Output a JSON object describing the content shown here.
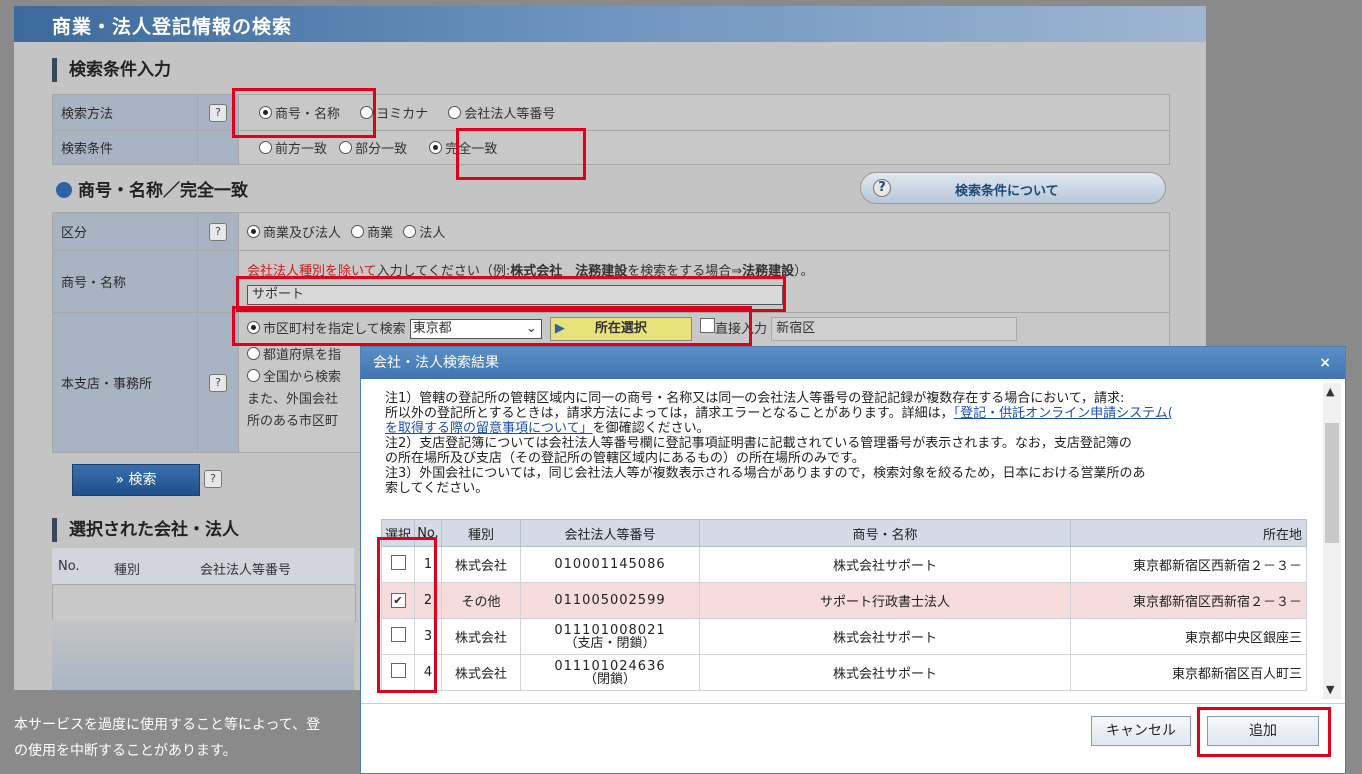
{
  "app_title": "商業・法人登記情報の検索",
  "section_search": "検索条件入力",
  "search_method": {
    "label": "検索方法",
    "help": "?",
    "options": [
      "商号・名称",
      "ヨミカナ",
      "会社法人等番号"
    ],
    "selected": "商号・名称"
  },
  "search_condition": {
    "label": "検索条件",
    "options": [
      "前方一致",
      "部分一致",
      "完全一致"
    ],
    "selected": "完全一致"
  },
  "subsection_title": "商号・名称／完全一致",
  "about_button": {
    "label": "検索条件について",
    "help": "?"
  },
  "category": {
    "label": "区分",
    "help": "?",
    "options": [
      "商業及び法人",
      "商業",
      "法人"
    ],
    "selected": "商業及び法人"
  },
  "name_field": {
    "label": "商号・名称",
    "note_link": "会社法人種別を除いて",
    "note_a": "入力してください（例:",
    "note_b": "株式会社　法務建設",
    "note_c": "を検索をする場合⇒",
    "note_d": "法務建設",
    "note_e": "）。",
    "value": "サポート"
  },
  "office": {
    "label": "本支店・事務所",
    "help": "?",
    "opt1": "市区町村を指定して検索",
    "prefecture": "東京都",
    "location_button": "所在選択",
    "direct_input": "直接入力",
    "city": "新宿区",
    "opt2": "都道府県を指",
    "opt3": "全国から検索",
    "line4": "また、外国会社",
    "line5": "所のある市区町"
  },
  "search_button": "» 検索",
  "search_help": "?",
  "section_selected": "選択された会社・法人",
  "selected_table_headers": [
    "No.",
    "種別",
    "会社法人等番号"
  ],
  "footer_text": [
    "本サービスを過度に使用すること等によって、登",
    "の使用を中断することがあります。"
  ],
  "modal": {
    "title": "会社・法人検索結果",
    "close": "×",
    "note1": "注1）管轄の登記所の管轄区域内に同一の商号・名称又は同一の会社法人等番号の登記記録が複数存在する場合において，請求:",
    "note1b": "所以外の登記所とするときは，請求方法によっては，請求エラーとなることがあります。詳細は，",
    "note1_link": "「登記・供託オンライン申請システム(",
    "note1_link2": "を取得する際の留意事項について」",
    "note1c": "を御確認ください。",
    "note2": "注2）支店登記簿については会社法人等番号欄に登記事項証明書に記載されている管理番号が表示されます。なお，支店登記簿の",
    "note2b": "の所在場所及び支店（その登記所の管轄区域内にあるもの）の所在場所のみです。",
    "note3": "注3）外国会社については，同じ会社法人等が複数表示される場合がありますので，検索対象を絞るため，日本における営業所のあ",
    "note3b": "索してください。",
    "headers": [
      "選択",
      "No.",
      "種別",
      "会社法人等番号",
      "商号・名称",
      "所在地"
    ],
    "rows": [
      {
        "checked": false,
        "no": "1",
        "type": "株式会社",
        "number": "010001145086",
        "sub": "",
        "name": "株式会社サポート",
        "address": "東京都新宿区西新宿２－３－"
      },
      {
        "checked": true,
        "no": "2",
        "type": "その他",
        "number": "011005002599",
        "sub": "",
        "name": "サポート行政書士法人",
        "address": "東京都新宿区西新宿２－３－"
      },
      {
        "checked": false,
        "no": "3",
        "type": "株式会社",
        "number": "011101008021",
        "sub": "（支店・閉鎖）",
        "name": "株式会社サポート",
        "address": "東京都中央区銀座三"
      },
      {
        "checked": false,
        "no": "4",
        "type": "株式会社",
        "number": "011101024636",
        "sub": "（閉鎖）",
        "name": "株式会社サポート",
        "address": "東京都新宿区百人町三"
      }
    ],
    "cancel": "キャンセル",
    "add": "追加"
  }
}
